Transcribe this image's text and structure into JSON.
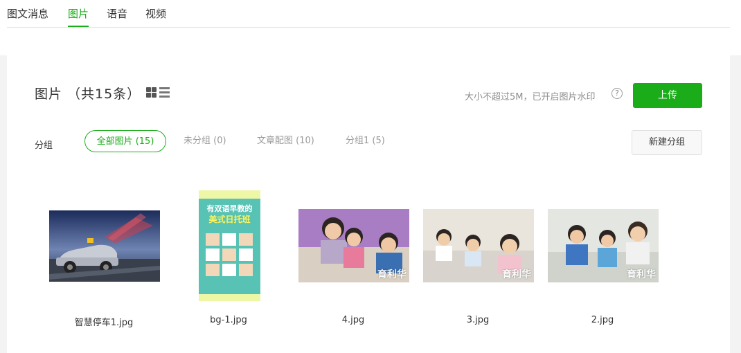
{
  "tabs": [
    {
      "label": "图文消息",
      "active": false
    },
    {
      "label": "图片",
      "active": true
    },
    {
      "label": "语音",
      "active": false
    },
    {
      "label": "视频",
      "active": false
    }
  ],
  "header": {
    "title": "图片 （共15条）",
    "hint": "大小不超过5M，已开启图片水印",
    "help_glyph": "?",
    "upload_label": "上传"
  },
  "groups": {
    "label": "分组",
    "items": [
      {
        "label": "全部图片 (15)",
        "active": true
      },
      {
        "label": "未分组 (0)",
        "active": false
      },
      {
        "label": "文章配图 (10)",
        "active": false
      },
      {
        "label": "分组1 (5)",
        "active": false
      }
    ],
    "new_group_label": "新建分组"
  },
  "images": [
    {
      "name": "智慧停车1.jpg",
      "icon": "car-photo"
    },
    {
      "name": "bg-1.jpg",
      "icon": "poster-photo",
      "poster_title_1": "有双语早教的",
      "poster_title_2": "美式日托班"
    },
    {
      "name": "4.jpg",
      "icon": "children-photo",
      "watermark": "育利华"
    },
    {
      "name": "3.jpg",
      "icon": "children-photo",
      "watermark": "育利华"
    },
    {
      "name": "2.jpg",
      "icon": "children-photo",
      "watermark": "育利华"
    }
  ],
  "colors": {
    "accent": "#1aad19",
    "background": "#f3f3f3"
  }
}
